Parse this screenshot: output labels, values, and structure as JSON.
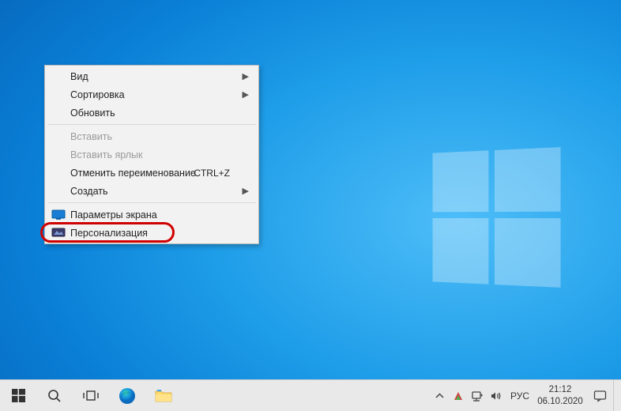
{
  "context_menu": {
    "groups": [
      [
        {
          "label": "Вид",
          "submenu": true
        },
        {
          "label": "Сортировка",
          "submenu": true
        },
        {
          "label": "Обновить"
        }
      ],
      [
        {
          "label": "Вставить",
          "disabled": true
        },
        {
          "label": "Вставить ярлык",
          "disabled": true
        },
        {
          "label": "Отменить переименование",
          "shortcut": "CTRL+Z"
        },
        {
          "label": "Создать",
          "submenu": true
        }
      ],
      [
        {
          "label": "Параметры экрана",
          "icon": "display",
          "highlighted": true
        },
        {
          "label": "Персонализация",
          "icon": "personalize"
        }
      ]
    ]
  },
  "taskbar": {
    "lang": "РУС",
    "time": "21:12",
    "date": "06.10.2020"
  }
}
